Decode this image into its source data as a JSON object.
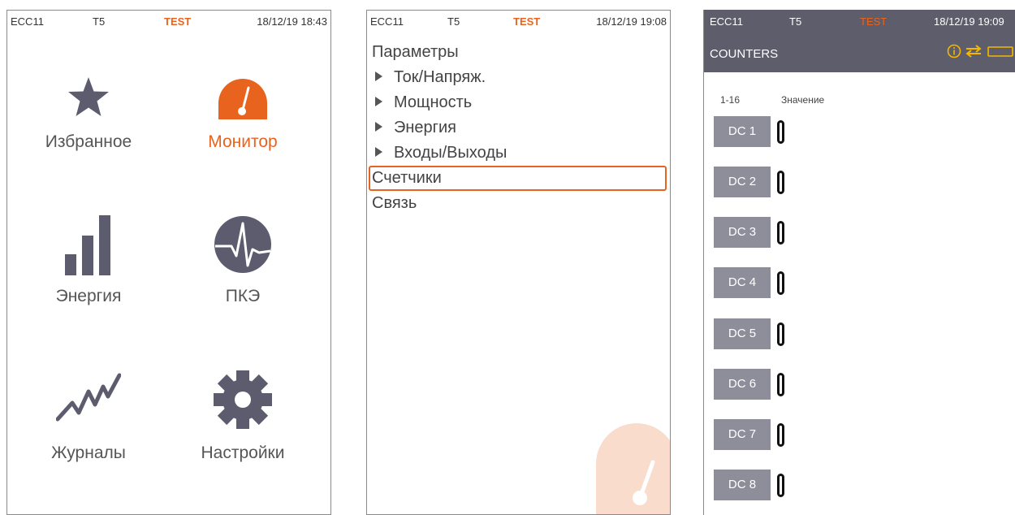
{
  "panel1": {
    "status": {
      "device": "ECC11",
      "id": "T5",
      "mode": "TEST",
      "datetime": "18/12/19 18:43"
    },
    "tiles": [
      {
        "label": "Избранное",
        "icon": "star-icon"
      },
      {
        "label": "Монитор",
        "icon": "gauge-icon"
      },
      {
        "label": "Энергия",
        "icon": "bar-chart-icon"
      },
      {
        "label": "ПКЭ",
        "icon": "waveform-icon"
      },
      {
        "label": "Журналы",
        "icon": "trend-line-icon"
      },
      {
        "label": "Настройки",
        "icon": "gear-icon"
      }
    ]
  },
  "panel2": {
    "status": {
      "device": "ECC11",
      "id": "T5",
      "mode": "TEST",
      "datetime": "18/12/19 19:08"
    },
    "menu": [
      {
        "label": "Параметры"
      },
      {
        "label": "Ток/Напряж."
      },
      {
        "label": "Мощность"
      },
      {
        "label": "Энергия"
      },
      {
        "label": "Входы/Выходы"
      },
      {
        "label": "Счетчики"
      },
      {
        "label": "Связь"
      }
    ]
  },
  "panel3": {
    "status": {
      "device": "ECC11",
      "id": "T5",
      "mode": "TEST",
      "datetime": "18/12/19 19:09"
    },
    "title": "COUNTERS",
    "icons": [
      "info-icon",
      "transfer-icon",
      "battery-icon"
    ],
    "col_range": "1-16",
    "col_value": "Значение",
    "counters": [
      {
        "label": "DC 1",
        "value": "0"
      },
      {
        "label": "DC 2",
        "value": "0"
      },
      {
        "label": "DC 3",
        "value": "0"
      },
      {
        "label": "DC 4",
        "value": "0"
      },
      {
        "label": "DC 5",
        "value": "0"
      },
      {
        "label": "DC 6",
        "value": "0"
      },
      {
        "label": "DC 7",
        "value": "0"
      },
      {
        "label": "DC 8",
        "value": "0"
      }
    ]
  },
  "colors": {
    "accent": "#e8641e",
    "icon": "#5c5c6e",
    "header": "#5d5d6b",
    "counter_bg": "#8e8e9b"
  }
}
